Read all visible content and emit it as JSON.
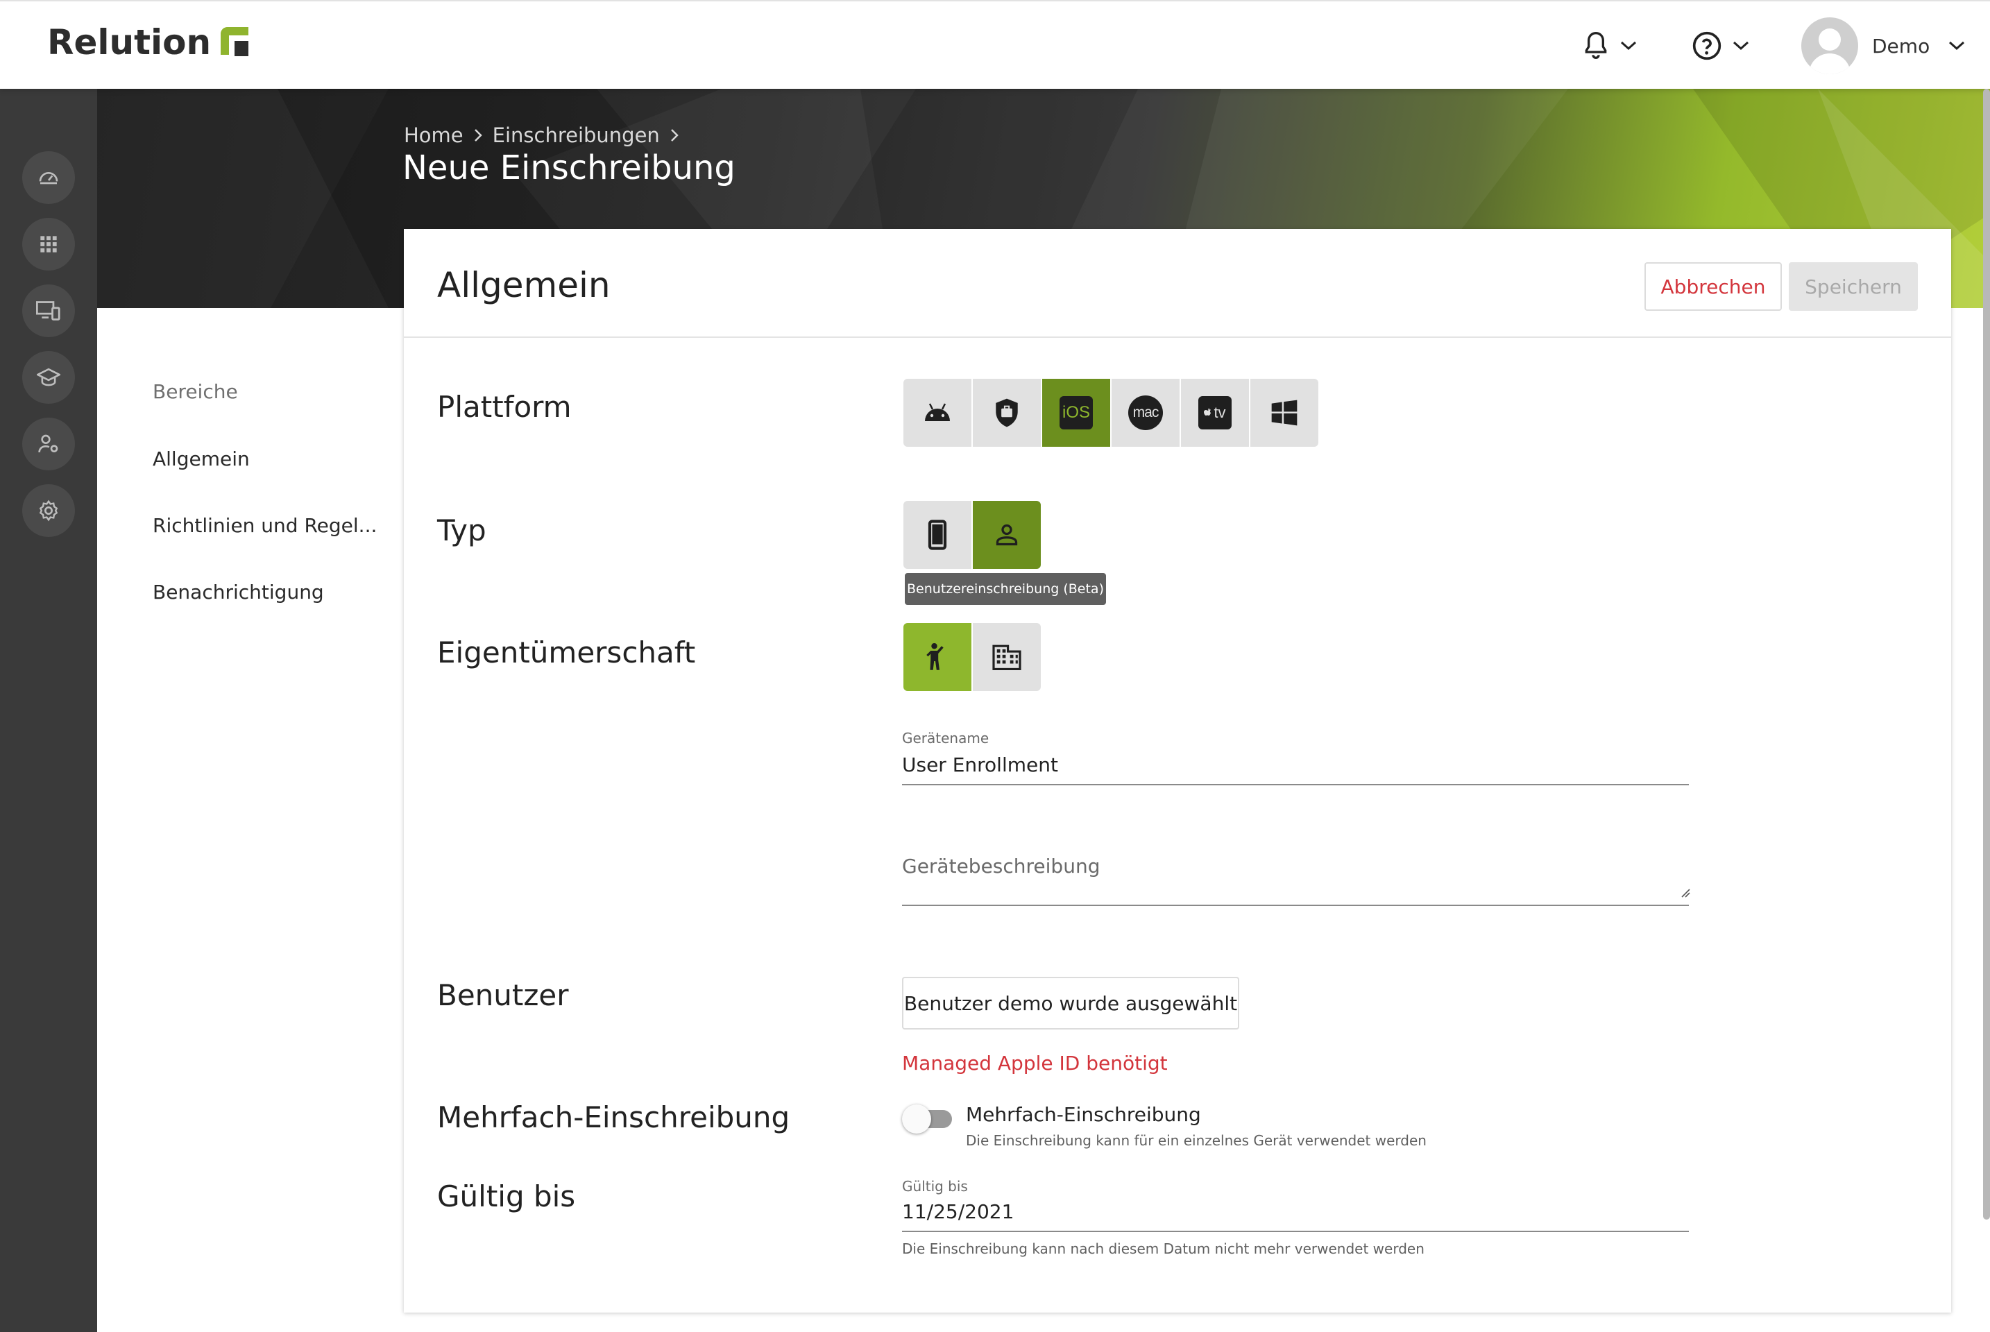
{
  "app": {
    "logo_text": "Relution"
  },
  "topbar": {
    "user_name": "Demo"
  },
  "breadcrumb": {
    "home": "Home",
    "enrollments": "Einschreibungen"
  },
  "page": {
    "title": "Neue Einschreibung"
  },
  "sidebar": {
    "icons": [
      "dashboard-icon",
      "apps-icon",
      "devices-icon",
      "education-icon",
      "user-settings-icon",
      "settings-icon"
    ]
  },
  "nav": {
    "heading": "Bereiche",
    "items": [
      {
        "label": "Allgemein"
      },
      {
        "label": "Richtlinien und Regel..."
      },
      {
        "label": "Benachrichtigung"
      }
    ]
  },
  "card": {
    "title": "Allgemein",
    "cancel_label": "Abbrechen",
    "save_label": "Speichern"
  },
  "form": {
    "platform": {
      "label": "Plattform",
      "options": [
        "android",
        "android-enterprise",
        "ios",
        "mac",
        "tv",
        "windows"
      ],
      "selected": "ios",
      "ios_text": "iOS",
      "mac_text": "mac",
      "tv_text": "tv"
    },
    "type": {
      "label": "Typ",
      "options": [
        "device-enrollment",
        "user-enrollment"
      ],
      "selected": "user-enrollment",
      "tooltip": "Benutzereinschreibung (Beta)"
    },
    "ownership": {
      "label": "Eigentümerschaft",
      "options": [
        "personal",
        "corporate"
      ],
      "selected": "personal"
    },
    "device_name": {
      "label": "Gerätename",
      "value": "User Enrollment"
    },
    "device_description": {
      "placeholder": "Gerätebeschreibung"
    },
    "user": {
      "label": "Benutzer",
      "button": "Benutzer demo wurde ausgewählt",
      "error": "Managed Apple ID benötigt"
    },
    "multi_enrollment": {
      "label": "Mehrfach-Einschreibung",
      "toggle_label": "Mehrfach-Einschreibung",
      "enabled": false,
      "hint": "Die Einschreibung kann für ein einzelnes Gerät verwendet werden"
    },
    "valid_until": {
      "label": "Gültig bis",
      "field_label": "Gültig bis",
      "value": "11/25/2021",
      "hint": "Die Einschreibung kann nach diesem Datum nicht mehr verwendet werden"
    }
  },
  "colors": {
    "accent": "#8eb72d",
    "accent_dark": "#6c8f1e",
    "error": "#d3353c",
    "sidebar_bg": "#3a3a3a"
  }
}
